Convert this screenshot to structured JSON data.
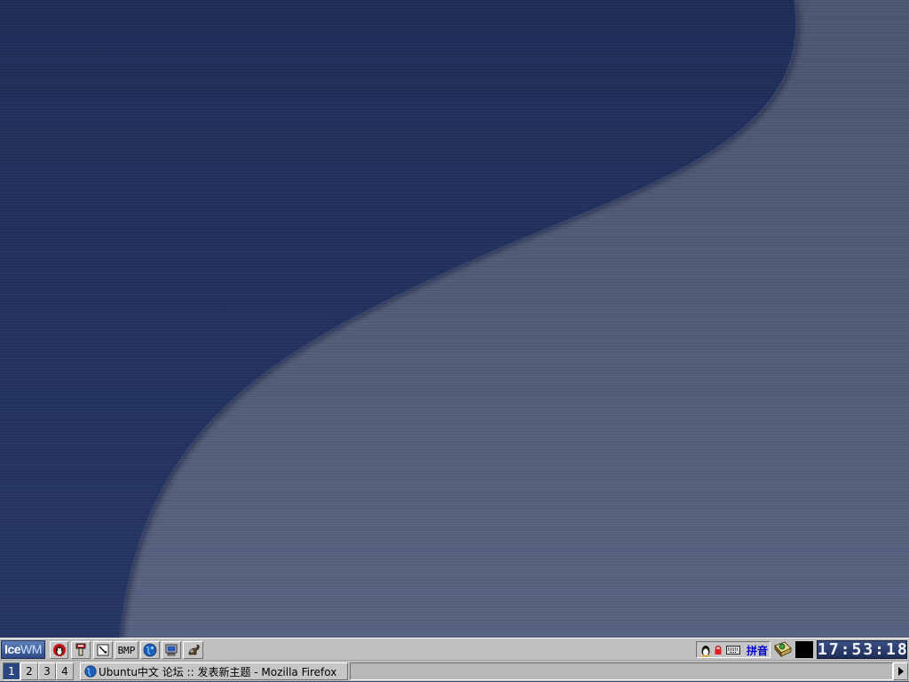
{
  "desktop": {
    "colors": {
      "dark_blue": "#243462",
      "slate": "#57647e"
    }
  },
  "taskbar": {
    "start_button": {
      "label_ice": "Ice",
      "label_wm": "WM"
    },
    "quick_launch": [
      {
        "name": "penguin-icon"
      },
      {
        "name": "terminal-icon"
      },
      {
        "name": "edit-icon"
      },
      {
        "name": "bmp-viewer",
        "label": "BMP"
      },
      {
        "name": "globe-icon"
      },
      {
        "name": "computer-icon"
      },
      {
        "name": "gimp-icon"
      }
    ],
    "tray": {
      "pinyin_label": "拼音"
    },
    "clock": "17:53:18",
    "workspaces": [
      "1",
      "2",
      "3",
      "4"
    ],
    "active_workspace": "1",
    "tasks": [
      {
        "title": "Ubuntu中文 论坛 :: 发表新主题 - Mozilla Firefox",
        "icon": "firefox-globe-icon"
      }
    ]
  }
}
